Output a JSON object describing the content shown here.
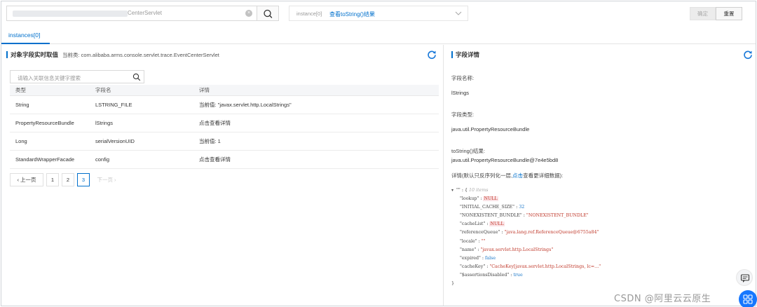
{
  "toolbar": {
    "search_value": "CenterServlet",
    "clear_icon": "×",
    "select_value": "instance[0]",
    "select_link": "查看toString()结果",
    "confirm_label": "确定",
    "reset_label": "重置"
  },
  "tabs": [
    {
      "label": "instances[0]"
    }
  ],
  "left": {
    "title": "对象字段实时取值",
    "subtitle": "当前类: com.alibaba.arms.console.servlet.trace.EventCenterServlet",
    "filter_placeholder": "请输入关联信息关键字搜索",
    "columns": [
      "类型",
      "字段名",
      "详情"
    ],
    "rows": [
      {
        "type": "String",
        "field": "LSTRING_FILE",
        "detail": "当前值: \"javax.servlet.http.LocalStrings\""
      },
      {
        "type": "PropertyResourceBundle",
        "field": "lStrings",
        "detail": "点击查看详情"
      },
      {
        "type": "Long",
        "field": "serialVersionUID",
        "detail": "当前值: 1"
      },
      {
        "type": "StandardWrapperFacade",
        "field": "config",
        "detail": "点击查看详情"
      }
    ],
    "pager": {
      "prev": "上一页",
      "pages": [
        "1",
        "2",
        "3"
      ],
      "current": "3",
      "next": "下一页"
    }
  },
  "right": {
    "title": "字段详情",
    "name_label": "字段名称:",
    "name_value": "lStrings",
    "type_label": "字段类型:",
    "type_value": "java.util.PropertyResourceBundle",
    "tostring_label": "toString()结果:",
    "tostring_value": "java.util.PropertyResourceBundle@7e4e5bd8",
    "note_pre": "详情(默认只反序列化一层,",
    "note_link": "点击",
    "note_post": "查看更详细数据):",
    "json": {
      "root": "\"\"",
      "count": "10 items",
      "items": [
        {
          "key": "\"lookup\"",
          "value": "NULL",
          "kind": "null"
        },
        {
          "key": "\"INITIAL_CACHE_SIZE\"",
          "value": "32",
          "kind": "num"
        },
        {
          "key": "\"NONEXISTENT_BUNDLE\"",
          "value": "\"NONEXISTENT_BUNDLE\"",
          "kind": "str"
        },
        {
          "key": "\"cacheList\"",
          "value": "NULL",
          "kind": "null"
        },
        {
          "key": "\"referenceQueue\"",
          "value": "\"java.lang.ref.ReferenceQueue@6755a84\"",
          "kind": "str"
        },
        {
          "key": "\"locale\"",
          "value": "\"\"",
          "kind": "str"
        },
        {
          "key": "\"name\"",
          "value": "\"javax.servlet.http.LocalStrings\"",
          "kind": "str"
        },
        {
          "key": "\"expired\"",
          "value": "false",
          "kind": "bool"
        },
        {
          "key": "\"cacheKey\"",
          "value": "\"CacheKey[javax.servlet.http.LocalStrings, lc=...\"",
          "kind": "str"
        },
        {
          "key": "\"$assertionsDisabled\"",
          "value": "true",
          "kind": "bool"
        }
      ],
      "close": "}"
    }
  },
  "watermark": "CSDN @阿里云云原生",
  "colors": {
    "accent": "#0070cc",
    "null_bg": "#fbe3e6",
    "null_text": "#c0392b"
  }
}
